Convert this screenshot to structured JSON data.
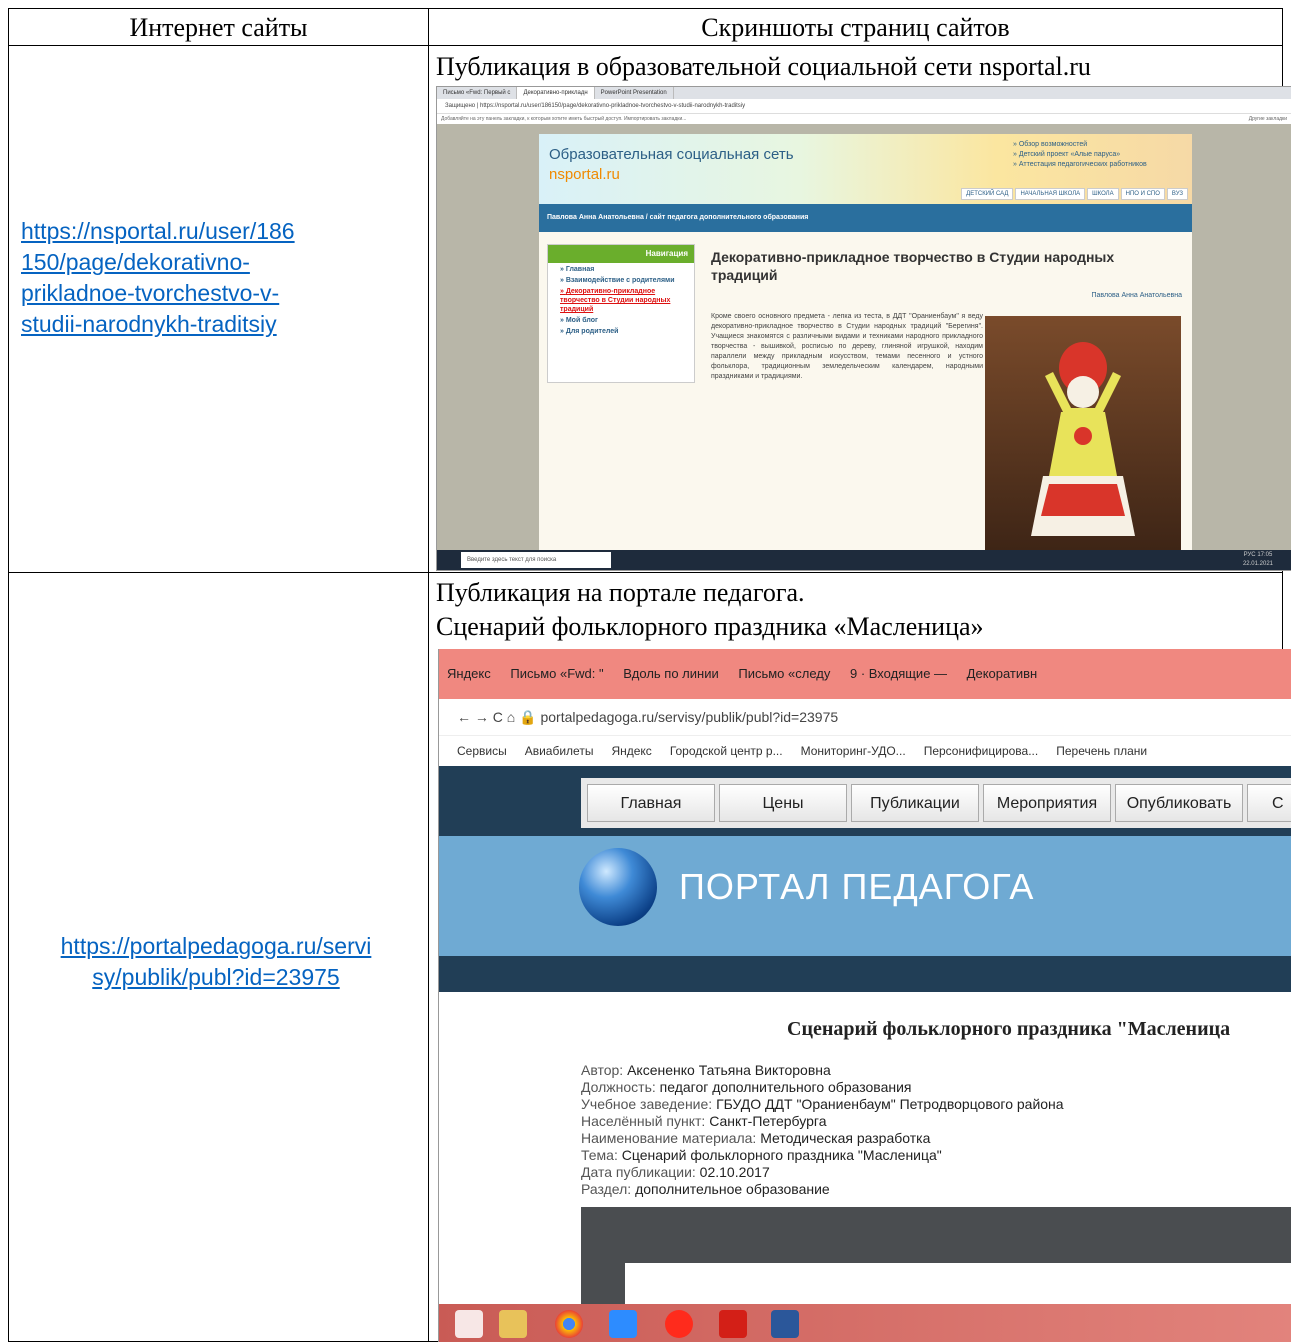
{
  "table": {
    "header_left": "Интернет сайты",
    "header_right": "Скриншоты страниц сайтов"
  },
  "rows": [
    {
      "link": "https://nsportal.ru/user/186150/page/dekorativno-prikladnoe-tvorchestvo-v-studii-narodnykh-traditsiy",
      "link_lines": [
        "https://nsportal.ru/user/186",
        "150/page/dekorativno-",
        "prikladnoe-tvorchestvo-v-",
        "studii-narodnykh-traditsiy"
      ],
      "caption": "Публикация в образовательной социальной сети nsportal.ru"
    },
    {
      "link": "https://portalpedagoga.ru/servisy/publik/publ?id=23975",
      "link_lines": [
        "https://portalpedagoga.ru/servi",
        "sy/publik/publ?id=23975"
      ],
      "caption_line1": "Публикация на портале педагога.",
      "caption_line2": "Сценарий фольклорного праздника «Масленица»"
    }
  ],
  "shot1": {
    "tabs": [
      "Письмо «Fwd: Первый с",
      "Декоративно-прикладн",
      "PowerPoint Presentation"
    ],
    "address": "Защищено | https://nsportal.ru/user/186150/page/dekorativno-prikladnoe-tvorchestvo-v-studii-narodnykh-traditsiy",
    "bookmarks_bar": "Добавляйте на эту панель закладки, к которым хотите иметь быстрый доступ. Импортировать закладки...",
    "other_bookmarks": "Другие закладки",
    "banner_title": "Образовательная социальная сеть",
    "banner_sub": "nsportal.ru",
    "banner_links": [
      "Обзор возможностей",
      "Детский проект «Алые паруса»",
      "Аттестация педагогических работников"
    ],
    "banner_nav": [
      "ДЕТСКИЙ САД",
      "НАЧАЛЬНАЯ ШКОЛА",
      "ШКОЛА",
      "НПО И СПО",
      "ВУЗ"
    ],
    "strip": "Павлова Анна Анатольевна / сайт педагога дополнительного образования",
    "nav_title": "Навигация",
    "nav_items": [
      "Главная",
      "Взаимодействие с родителями",
      "Декоративно-прикладное творчество в Студии народных традиций",
      "Мой блог",
      "Для родителей"
    ],
    "article_title": "Декоративно-прикладное творчество в Студии народных традиций",
    "article_author": "Павлова Анна Анатольевна",
    "article_text": "Кроме своего основного предмета - лепка из теста, в ДДТ \"Ораниенбаум\" я веду декоративно-прикладное творчество в Студии народных традиций \"Берегиня\". Учащиеся знакомятся с различными видами и техниками народного прикладного творчества - вышивкой, росписью по дереву, глиняной игрушкой, находим параллели между прикладным искусством, темами песенного и устного фольклора, традиционным земледельческим календарем, народными праздниками и традициями.",
    "search_placeholder": "Введите здесь текст для поиска",
    "tray": "РУС",
    "time": "17:05",
    "date": "22.01.2021"
  },
  "shot2": {
    "tabs": [
      "Яндекс",
      "Письмо «Fwd: \"",
      "Вдоль по линии",
      "Письмо «следу",
      "9 · Входящие —",
      "Декоративн"
    ],
    "address": "portalpedagoga.ru/servisy/publik/publ?id=23975",
    "bookmarks": [
      "Сервисы",
      "Авиабилеты",
      "Яндекс",
      "Городской центр р...",
      "Мониторинг-УДО...",
      "Персонифицирова...",
      "Перечень плани"
    ],
    "menu": [
      "Главная",
      "Цены",
      "Публикации",
      "Мероприятия",
      "Опубликовать",
      "С"
    ],
    "hero_title": "ПОРТАЛ ПЕДАГОГА",
    "pub_title": "Сценарий фольклорного праздника \"Масленица",
    "meta": [
      {
        "key": "Автор:",
        "value": "Аксененко Татьяна Викторовна"
      },
      {
        "key": "Должность:",
        "value": "педагог дополнительного образования"
      },
      {
        "key": "Учебное заведение:",
        "value": "ГБУДО ДДТ \"Ораниенбаум\" Петродворцового района"
      },
      {
        "key": "Населённый пункт:",
        "value": "Санкт-Петербурга"
      },
      {
        "key": "Наименование материала:",
        "value": "Методическая разработка"
      },
      {
        "key": "Тема:",
        "value": "Сценарий фольклорного праздника \"Масленица\""
      },
      {
        "key": "Дата публикации:",
        "value": "02.10.2017"
      },
      {
        "key": "Раздел:",
        "value": "дополнительное образование"
      }
    ]
  }
}
